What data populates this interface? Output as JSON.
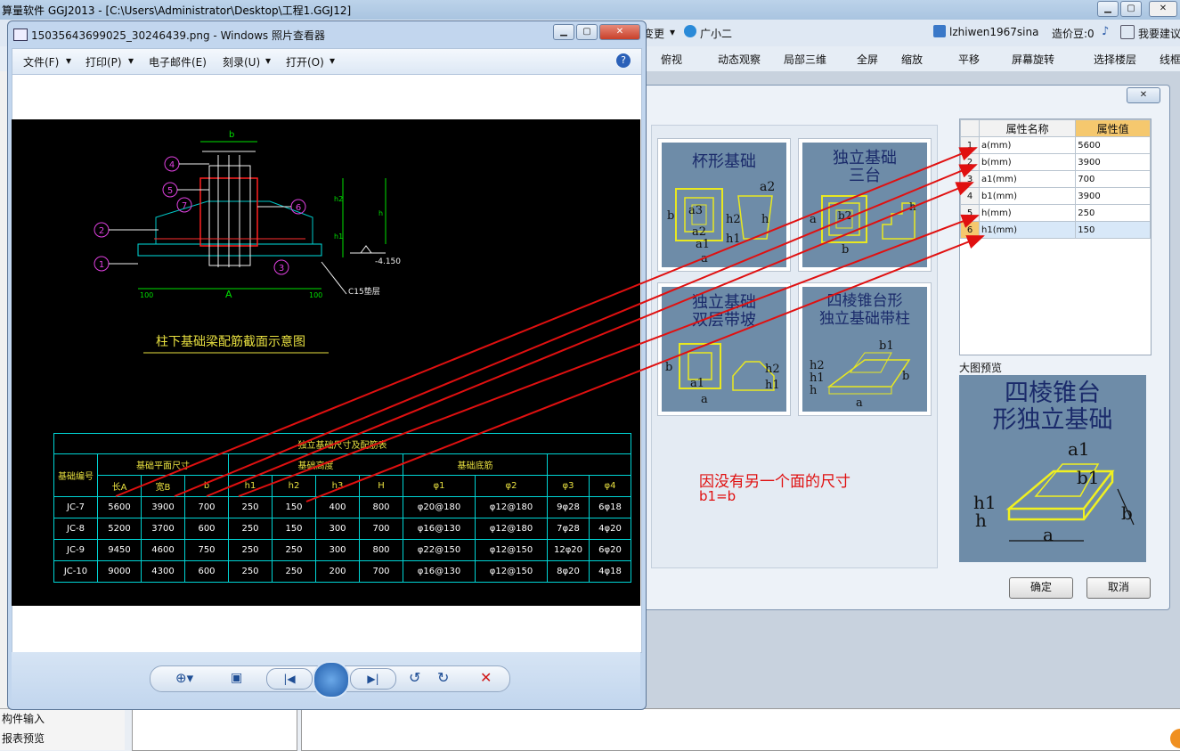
{
  "app": {
    "title": "算量软件 GGJ2013 - [C:\\Users\\Administrator\\Desktop\\工程1.GGJ12]",
    "menu_items": [
      "变更",
      "广小二",
      "lzhiwen1967sina",
      "造价豆:0",
      "我要建议"
    ],
    "toolbar_items": [
      "俯视",
      "动态观察",
      "局部三维",
      "全屏",
      "缩放",
      "平移",
      "屏幕旋转",
      "选择楼层",
      "线框"
    ],
    "bottom_left_items": [
      "构件输入",
      "报表预览"
    ],
    "colors": {
      "accent": "#e01010"
    }
  },
  "viewer": {
    "title": "15035643699025_30246439.png - Windows 照片查看器",
    "menu": [
      "文件(F)",
      "打印(P)",
      "电子邮件(E)",
      "刻录(U)",
      "打开(O)"
    ],
    "cad": {
      "drawing_title": "柱下基础梁配筋截面示意图",
      "labels": {
        "b": "b",
        "A": "A",
        "h1": "h1",
        "h2": "h2",
        "h": "h",
        "dim100a": "100",
        "dim100b": "100",
        "elev": "-4.150",
        "c15": "C15垫层"
      },
      "callouts": [
        "1",
        "2",
        "3",
        "4",
        "5",
        "6",
        "7"
      ],
      "table": {
        "caption": "独立基础尺寸及配筋表",
        "col_id": "基础编号",
        "grp_plan": "基础平面尺寸",
        "grp_height": "基础高度",
        "grp_rebar": "基础底筋",
        "sub_headers": [
          "长A",
          "宽B",
          "b",
          "h1",
          "h2",
          "h3",
          "H",
          "φ1",
          "φ2",
          "φ3",
          "φ4"
        ],
        "rows": [
          [
            "JC-7",
            "5600",
            "3900",
            "700",
            "250",
            "150",
            "400",
            "800",
            "φ20@180",
            "φ12@180",
            "9φ28",
            "6φ18"
          ],
          [
            "JC-8",
            "5200",
            "3700",
            "600",
            "250",
            "150",
            "300",
            "700",
            "φ16@130",
            "φ12@180",
            "7φ28",
            "4φ20"
          ],
          [
            "JC-9",
            "9450",
            "4600",
            "750",
            "250",
            "250",
            "300",
            "800",
            "φ22@150",
            "φ12@150",
            "12φ20",
            "6φ20"
          ],
          [
            "JC-10",
            "9000",
            "4300",
            "600",
            "250",
            "250",
            "200",
            "700",
            "φ16@130",
            "φ12@150",
            "8φ20",
            "4φ18"
          ]
        ]
      }
    }
  },
  "dialog": {
    "cards": [
      {
        "title": "杯形基础"
      },
      {
        "title": "独立基础\n三台"
      },
      {
        "title": "独立基础\n双层带坡"
      },
      {
        "title": "四棱锥台形\n独立基础带柱"
      }
    ],
    "note_line1": "因没有另一个面的尺寸",
    "note_line2": "b1=b",
    "prop_headers": {
      "name": "属性名称",
      "value": "属性值"
    },
    "props": [
      {
        "idx": "1",
        "name": "a(mm)",
        "value": "5600"
      },
      {
        "idx": "2",
        "name": "b(mm)",
        "value": "3900"
      },
      {
        "idx": "3",
        "name": "a1(mm)",
        "value": "700"
      },
      {
        "idx": "4",
        "name": "b1(mm)",
        "value": "3900"
      },
      {
        "idx": "5",
        "name": "h(mm)",
        "value": "250"
      },
      {
        "idx": "6",
        "name": "h1(mm)",
        "value": "150"
      }
    ],
    "preview_label": "大图预览",
    "preview_title": "四棱锥台\n形独立基础",
    "ok": "确定",
    "cancel": "取消"
  }
}
